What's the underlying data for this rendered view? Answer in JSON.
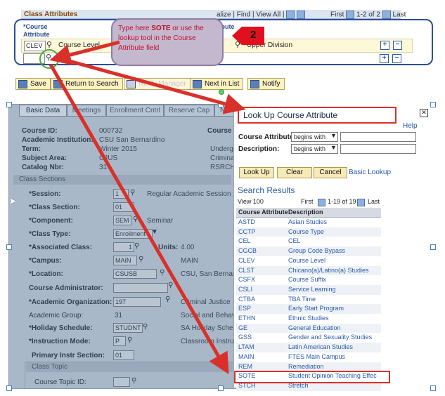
{
  "grid": {
    "title": "Class Attributes",
    "nav": "alize | Find | View All |",
    "first_label": "First",
    "range": "1-2 of 2",
    "last_label": "Last",
    "col_attribute": "*Course Attribute",
    "col_value": "ibute",
    "row1": {
      "attr": "CLEV",
      "desc": "Course Level",
      "value_desc": "Upper Division"
    },
    "row2": {
      "attr": "",
      "desc": ""
    }
  },
  "callout": {
    "text_pre": "Type here ",
    "text_bold": "SOTE",
    "text_post": " or use the lookup tool in the Course Attribute field",
    "badge": "2"
  },
  "toolbar": {
    "save": "Save",
    "return": "Return to Search",
    "notify_greyed": "Notify Manager",
    "next_in_list": "Next in List",
    "notify": "Notify"
  },
  "tabs": [
    "Basic Data",
    "Meetings",
    "Enrollment Cntrl",
    "Reserve Cap",
    "Notes"
  ],
  "basic": {
    "course_id_lbl": "Course ID:",
    "course_id": "000732",
    "course_lbl": "Course",
    "institution_lbl": "Academic Institution:",
    "institution": "CSU San Bernardino",
    "term_lbl": "Term:",
    "term": "Winter 2015",
    "term_extra": "Underg",
    "subject_lbl": "Subject Area:",
    "subject": "CJUS",
    "subject_extra": "Crimina",
    "catalog_lbl": "Catalog Nbr:",
    "catalog": "31",
    "catalog_extra": "RSRCH"
  },
  "class_sections": {
    "title": "Class Sections",
    "session_lbl": "*Session:",
    "session": "1",
    "session_desc": "Regular Academic Session",
    "section_lbl": "*Class Section:",
    "section": "01",
    "component_lbl": "*Component:",
    "component": "SEM",
    "component_desc": "Seminar",
    "class_type_lbl": "*Class Type:",
    "class_type": "Enrollment",
    "assoc_lbl": "*Associated Class:",
    "assoc": "1",
    "units_lbl": "Units:",
    "units": "4.00",
    "campus_lbl": "*Campus:",
    "campus": "MAIN",
    "campus_desc": "MAIN",
    "location_lbl": "*Location:",
    "location": "CSUSB",
    "location_desc": "CSU, San Bernard",
    "admin_lbl": "Course Administrator:",
    "org_lbl": "*Academic Organization:",
    "org": "197",
    "org_desc": "Criminal Justice",
    "group_lbl": "Academic Group:",
    "group": "31",
    "group_desc": "Social and Behavi",
    "holiday_lbl": "*Holiday Schedule:",
    "holiday": "STUDNT",
    "holiday_desc": "SA Holiday Schedu",
    "instr_lbl": "*Instruction Mode:",
    "instr": "P",
    "instr_desc": "Classroom Instruc",
    "primary_lbl": "Primary Instr Section:",
    "primary": "01",
    "topic_title": "Class Topic",
    "topic_lbl": "Course Topic ID:"
  },
  "lookup": {
    "title": "Look Up Course Attribute",
    "help": "Help",
    "attr_lbl": "Course Attribute:",
    "desc_lbl": "Description:",
    "operator": "begins with",
    "look_up": "Look Up",
    "clear": "Clear",
    "cancel": "Cancel",
    "basic_lookup": "Basic Lookup",
    "results_title": "Search Results",
    "view": "View 100",
    "first": "First",
    "range": "1-19 of 19",
    "last": "Last",
    "col1": "Course Attribute",
    "col2": "Description",
    "rows": [
      {
        "code": "ASTD",
        "desc": "Asian Studies"
      },
      {
        "code": "CCTP",
        "desc": "Course Type"
      },
      {
        "code": "CEL",
        "desc": "CEL"
      },
      {
        "code": "CGCB",
        "desc": "Group Code Bypass"
      },
      {
        "code": "CLEV",
        "desc": "Course Level"
      },
      {
        "code": "CLST",
        "desc": "Chicano(a)/Latino(a) Studies"
      },
      {
        "code": "CSFX",
        "desc": "Course Suffix"
      },
      {
        "code": "CSLI",
        "desc": "Service Learning"
      },
      {
        "code": "CTBA",
        "desc": "TBA Time"
      },
      {
        "code": "ESP",
        "desc": "Early Start Program"
      },
      {
        "code": "ETHN",
        "desc": "Ethnic Studies"
      },
      {
        "code": "GE",
        "desc": "General Education"
      },
      {
        "code": "GSS",
        "desc": "Gender and Sexuality Studies"
      },
      {
        "code": "LTAM",
        "desc": "Latin American Studies"
      },
      {
        "code": "MAIN",
        "desc": "FTES Main Campus"
      },
      {
        "code": "REM",
        "desc": "Remediation"
      },
      {
        "code": "SOTE",
        "desc": "Student Opinion Teaching Effec"
      },
      {
        "code": "STCH",
        "desc": "Stretch"
      }
    ]
  },
  "colors": {
    "annotation_red": "#d9302a",
    "accent_blue": "#2a5ba8",
    "highlight_box": "#2f4f8f"
  }
}
